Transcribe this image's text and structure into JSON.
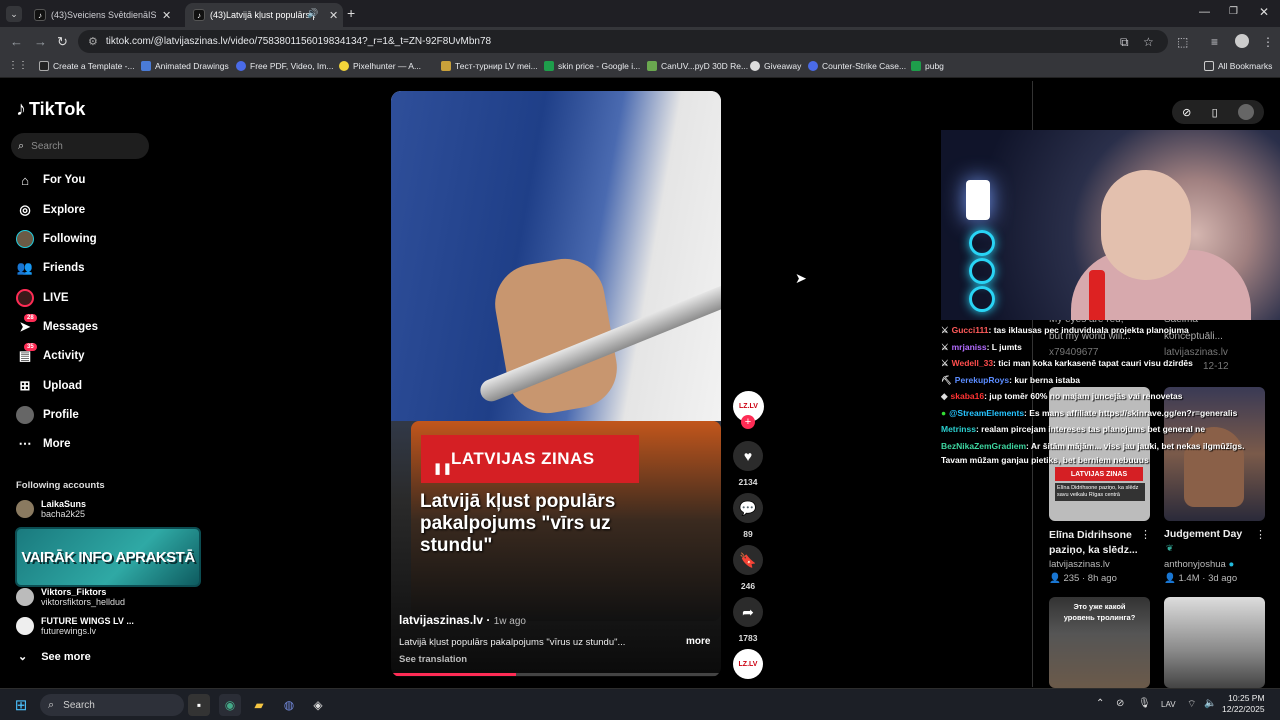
{
  "browser": {
    "tabs": [
      {
        "title": "(43)Sveiciens SvētdienāISveicien",
        "icon": "tiktok-icon"
      },
      {
        "title": "(43)Latvijā kļust populārs pa",
        "icon": "tiktok-icon"
      }
    ],
    "url": "tiktok.com/@latvijaszinas.lv/video/7583801156019834134?_r=1&_t=ZN-92F8UvMbn78",
    "bookmarks": [
      "Create a Template -...",
      "Animated Drawings",
      "Free PDF, Video, Im...",
      "Pixelhunter — A...",
      "Тест-турнир LV mei...",
      "skin price - Google i...",
      "CanUV...pyD 30D Re...",
      "Giveaway",
      "Counter-Strike Case...",
      "pubg"
    ],
    "all_bookmarks": "All Bookmarks"
  },
  "tiktok": {
    "logo": "TikTok",
    "search_placeholder": "Search",
    "nav": [
      {
        "label": "For You",
        "icon": "home-icon"
      },
      {
        "label": "Explore",
        "icon": "compass-icon"
      },
      {
        "label": "Following",
        "icon": "following-icon"
      },
      {
        "label": "Friends",
        "icon": "friends-icon"
      },
      {
        "label": "LIVE",
        "icon": "live-icon"
      },
      {
        "label": "Messages",
        "icon": "messages-icon",
        "badge": "28"
      },
      {
        "label": "Activity",
        "icon": "activity-icon",
        "badge": "35"
      },
      {
        "label": "Upload",
        "icon": "upload-icon"
      },
      {
        "label": "Profile",
        "icon": "profile-icon"
      },
      {
        "label": "More",
        "icon": "more-icon"
      }
    ],
    "following_title": "Following accounts",
    "accounts": [
      {
        "name": "LaikaSuns",
        "handle": "bacha2k25"
      },
      {
        "name": "Viktors_Fiktors",
        "handle": "viktorsfiktors_helldud"
      },
      {
        "name": "FUTURE WINGS LV ...",
        "handle": "futurewings.lv"
      }
    ],
    "promo": "VAIRĀK INFO APRAKSTĀ",
    "see_more": "See more"
  },
  "video": {
    "banner": "LATVIJAS ZINAS",
    "headline": "Latvijā kļust populārs pakalpojums \"vīrs uz stundu\"",
    "author": "latvijaszinas.lv",
    "ago": "1w ago",
    "description": "Latvijā kļust populārs pakalpojums \"vīrus uz stundu\"...",
    "more": "more",
    "see_translation": "See translation",
    "progress": 0.38,
    "avatar_text": "LZ.LV",
    "likes": "2134",
    "comments": "89",
    "saves": "246",
    "shares": "1783"
  },
  "chat": [
    {
      "user": "Gucci111",
      "color": "#ff5a5a",
      "text": ": tas iklausas pec induviduala projekta planojuma"
    },
    {
      "user": "mrjaniss",
      "color": "#b36cff",
      "text": ": L jumts"
    },
    {
      "user": "Wedell_33",
      "color": "#ff4d4d",
      "text": ": tici man koka karkasenē tapat cauri visu dzirdēs"
    },
    {
      "user": "PerekupRoys",
      "color": "#5b8cff",
      "text": ": kur berna istaba"
    },
    {
      "user": "skaba16",
      "color": "#ff3333",
      "text": ": jup tomēr 60% no majam juncejās vai renovetas"
    },
    {
      "user": "@StreamElements",
      "color": "#27c4ff",
      "text": ": Es mans affiliate https://skinrave.gg/en?r=generalis"
    },
    {
      "user": "Metrinss",
      "color": "#2bd0d0",
      "text": ": realam pircejam intereses tas planojums bet general ne"
    },
    {
      "user": "BezNikaZemGradiem",
      "color": "#3dd6a0",
      "text": ": Ar šitām mājām... viss jau jauki, bet nekas ilgmūžīgs."
    },
    {
      "user": "",
      "color": "#fff",
      "text": "Tavam mūžam ganjau pietiks, bet berniem nebuuus"
    }
  ],
  "grid": {
    "behind_chat": [
      "My eyes are red,",
      "but my world will...",
      "x79409677",
      "Saeima",
      "konceptuāli...",
      "latvijaszinas.lv",
      "12-12"
    ],
    "cards": [
      {
        "thumb_title": "LATVIJAS ZINAS",
        "thumb_text": "Elīna Didrihsone paziņo, ka slēdz savu veikalu Rīgas centrā",
        "title": "Elīna Didrihsone paziņo, ka slēdz...",
        "author": "latvijaszinas.lv",
        "views": "235",
        "ago": "8h ago"
      },
      {
        "title": "Judgement Day",
        "author": "anthonyjoshua",
        "views": "1.4M",
        "ago": "3d ago"
      },
      {
        "thumb_text": "Это уже какой уровень тролинга?"
      }
    ]
  },
  "taskbar": {
    "search": "Search",
    "lang": "LAV",
    "time": "10:25 PM",
    "date": "12/22/2025"
  }
}
